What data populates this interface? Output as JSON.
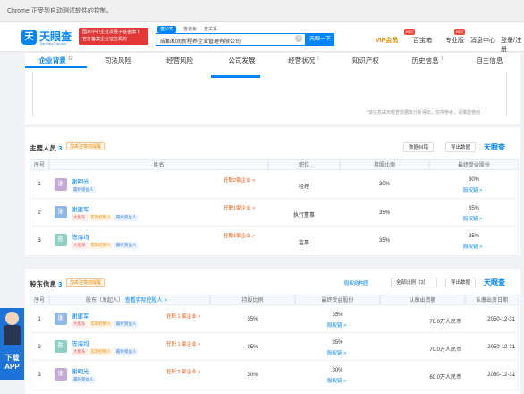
{
  "chrome_info": "Chrome 正受到自动测试软件的控制。",
  "logo": {
    "mark": "天",
    "name": "天眼查",
    "domain": "TianYanCha.com"
  },
  "banner": {
    "line1": "国家中小企业发展子基金旗下",
    "line2": "官方备案企业征信机构"
  },
  "search_tabs": [
    "查公司",
    "查老板",
    "查关系"
  ],
  "search": {
    "value": "成都和润新程养企业管理有限公司",
    "button": "天眼一下"
  },
  "header_nav": {
    "vip": "VIP会员",
    "items": [
      "百宝箱",
      "专业版",
      "消息中心",
      "登录/注册"
    ],
    "hot": "HOT"
  },
  "tabs": [
    {
      "label": "企业背景",
      "count": "12"
    },
    {
      "label": "司法风险",
      "count": ""
    },
    {
      "label": "经营风险",
      "count": ""
    },
    {
      "label": "公司发展",
      "count": ""
    },
    {
      "label": "经营状况",
      "count": "2"
    },
    {
      "label": "知识产权",
      "count": ""
    },
    {
      "label": "历史信息",
      "count": "1"
    },
    {
      "label": "自主信息",
      "count": ""
    }
  ],
  "disclaimer": "*该信息由天眼查数据库分析得出，仅供参考，请慎重使用",
  "watermark": "天眼查",
  "personnel": {
    "title": "主要人员",
    "count": "3",
    "follow": "加关注变动提醒",
    "btn1": "数据纠错",
    "btn2": "导出数据",
    "headers": [
      "序号",
      "姓名",
      "职位",
      "持股比例",
      "最终受益股份"
    ],
    "rows": [
      {
        "no": "1",
        "av": "谢",
        "color": "#c5a9d6",
        "name": "谢明光",
        "tags": [
          "最终受益人"
        ],
        "rel": "任职2家企业 >",
        "pos": "经理",
        "share": "30%",
        "final": "30%",
        "link": "股权链 >"
      },
      {
        "no": "2",
        "av": "谢",
        "color": "#8fb9e6",
        "name": "谢建军",
        "tags": [
          "大股东",
          "实际控制人",
          "最终受益人"
        ],
        "rel": "任职1家企业 >",
        "pos": "执行董事",
        "share": "35%",
        "final": "35%",
        "link": "股权链 >"
      },
      {
        "no": "3",
        "av": "陈",
        "color": "#8fd0c4",
        "name": "陈海均",
        "tags": [
          "大股东",
          "实际控制人",
          "最终受益人"
        ],
        "rel": "任职1家企业 >",
        "pos": "监事",
        "share": "35%",
        "final": "35%",
        "link": "股权链 >"
      }
    ]
  },
  "shareholders": {
    "title": "股东信息",
    "count": "3",
    "follow": "加关注变动提醒",
    "struct": "股权结构图",
    "sort": "全部比例（3）",
    "btn": "导出数据",
    "headers": [
      "序号",
      "股东（发起人）",
      "查看实际控股人 >",
      "持股比例",
      "最终受益股份",
      "认缴出资额",
      "认缴出资日期"
    ],
    "rows": [
      {
        "no": "1",
        "av": "谢",
        "color": "#8fb9e6",
        "name": "谢建军",
        "tags": [
          "大股东",
          "实际控制人",
          "最终受益人"
        ],
        "rel": "任职 1 家企业 >",
        "share": "35%",
        "final": "35%",
        "link": "股权链 >",
        "amount": "70.0万人民币",
        "date": "2050-12-31"
      },
      {
        "no": "2",
        "av": "陈",
        "color": "#8fd0c4",
        "name": "陈海均",
        "tags": [
          "大股东",
          "实际控制人",
          "最终受益人"
        ],
        "rel": "任职 1 家企业 >",
        "share": "35%",
        "final": "35%",
        "link": "股权链 >",
        "amount": "70.0万人民币",
        "date": "2050-12-31"
      },
      {
        "no": "3",
        "av": "谢",
        "color": "#c5a9d6",
        "name": "谢明光",
        "tags": [
          "最终受益人"
        ],
        "rel": "任职 2 家企业 >",
        "share": "30%",
        "final": "30%",
        "link": "股权链 >",
        "amount": "60.0万人民币",
        "date": "2050-12-31"
      }
    ]
  },
  "download": {
    "label": "下载",
    "app": "APP"
  }
}
